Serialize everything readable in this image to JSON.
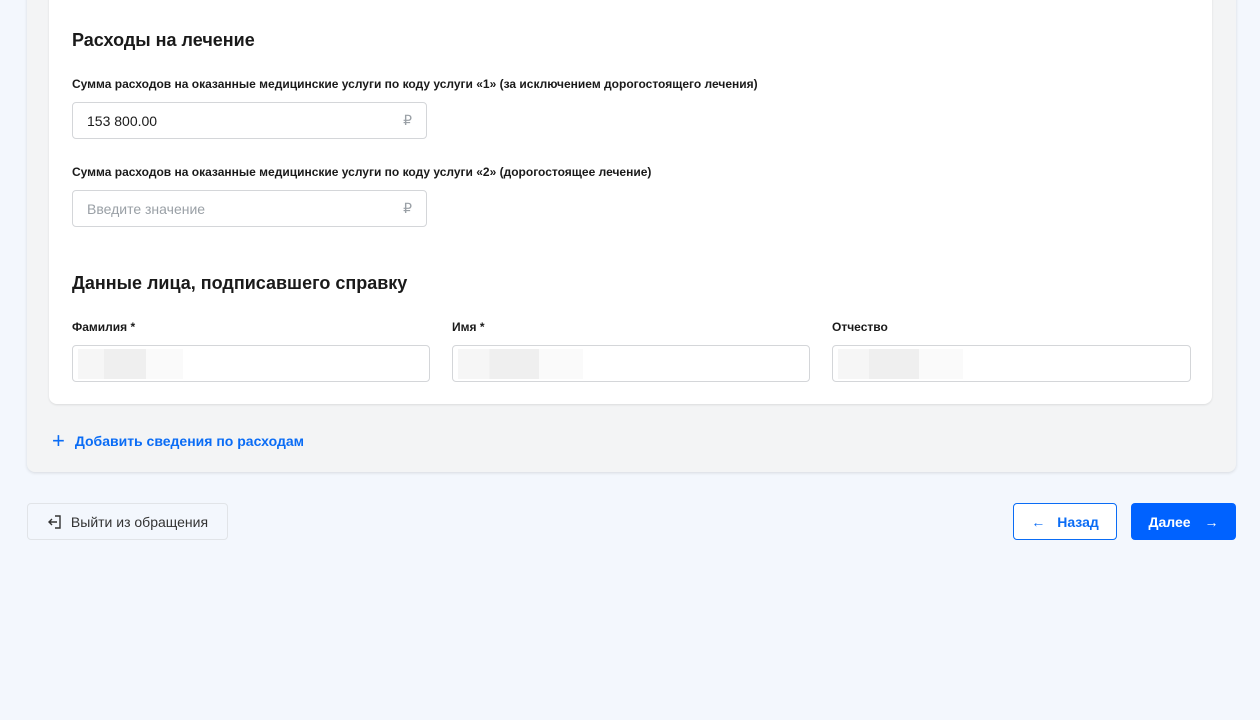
{
  "treatment": {
    "title": "Расходы на лечение",
    "field1": {
      "label": "Сумма расходов на оказанные медицинские услуги по коду услуги «1» (за исключением дорогостоящего лечения)",
      "value": "153 800.00",
      "currency": "₽"
    },
    "field2": {
      "label": "Сумма расходов на оказанные медицинские услуги по коду услуги «2» (дорогостоящее лечение)",
      "placeholder": "Введите значение",
      "currency": "₽"
    }
  },
  "signer": {
    "title": "Данные лица, подписавшего справку",
    "surname_label": "Фамилия *",
    "name_label": "Имя *",
    "patronymic_label": "Отчество"
  },
  "add_expenses": "Добавить сведения по расходам",
  "footer": {
    "exit": "Выйти из обращения",
    "back": "Назад",
    "next": "Далее",
    "back_arrow": "←",
    "next_arrow": "→"
  }
}
